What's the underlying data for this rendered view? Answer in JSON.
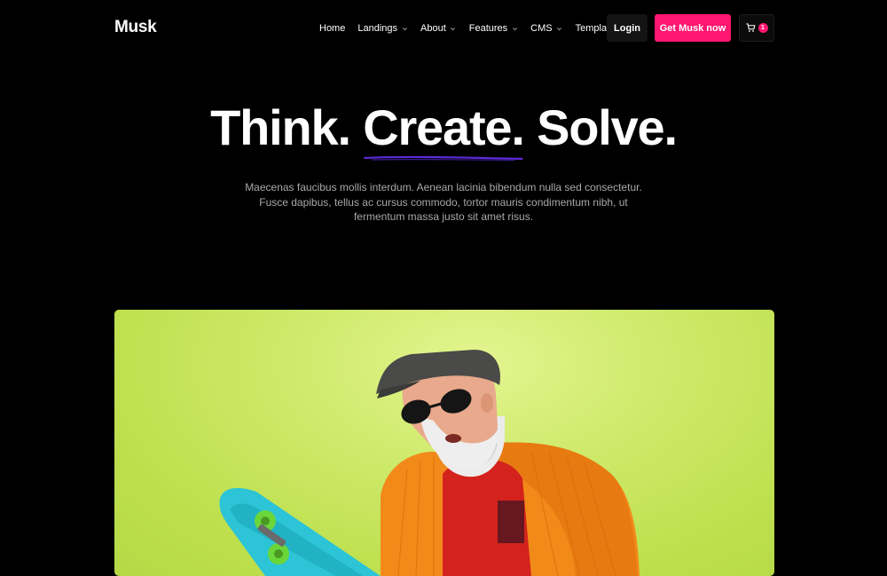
{
  "nav": {
    "logo": "Musk",
    "menu": [
      {
        "label": "Home",
        "has_dropdown": false
      },
      {
        "label": "Landings",
        "has_dropdown": true
      },
      {
        "label": "About",
        "has_dropdown": true
      },
      {
        "label": "Features",
        "has_dropdown": true
      },
      {
        "label": "CMS",
        "has_dropdown": true
      },
      {
        "label": "Template",
        "has_dropdown": true
      }
    ],
    "login_label": "Login",
    "cta_label": "Get Musk now",
    "cart_count": "1"
  },
  "hero": {
    "title_part1": "Think.",
    "title_highlight": "Create.",
    "title_part2": "Solve.",
    "description": "Maecenas faucibus mollis interdum. Aenean lacinia bibendum nulla sed consectetur. Fusce dapibus, tellus ac cursus commodo, tortor mauris condimentum nibh, ut fermentum massa justo sit amet risus."
  },
  "colors": {
    "accent": "#ff1670",
    "underline": "#5b2bd6",
    "background": "#000000",
    "image_bg": "#c5e55a"
  },
  "icons": {
    "dropdown": "chevron-down-icon",
    "cart": "cart-icon"
  }
}
